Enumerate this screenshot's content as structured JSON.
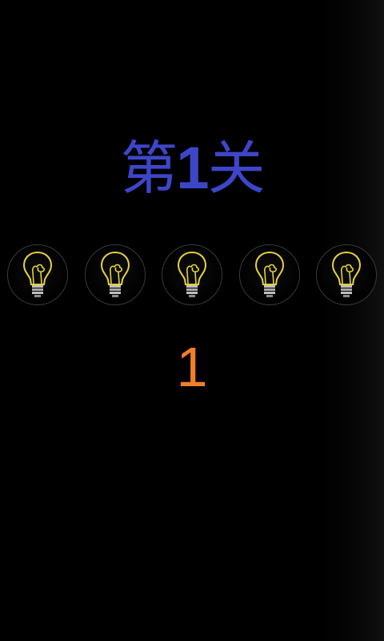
{
  "level": {
    "prefix": "第",
    "number": "1",
    "suffix": "关"
  },
  "bulbs": [
    {
      "state": "lit",
      "icon": "lightbulb-icon"
    },
    {
      "state": "lit",
      "icon": "lightbulb-icon"
    },
    {
      "state": "lit",
      "icon": "lightbulb-icon"
    },
    {
      "state": "lit",
      "icon": "lightbulb-icon"
    },
    {
      "state": "lit",
      "icon": "lightbulb-icon"
    }
  ],
  "answer": "1",
  "colors": {
    "title": "#3d46c9",
    "answer": "#f07e27",
    "bulb": "#e6d23a",
    "background": "#000000"
  }
}
